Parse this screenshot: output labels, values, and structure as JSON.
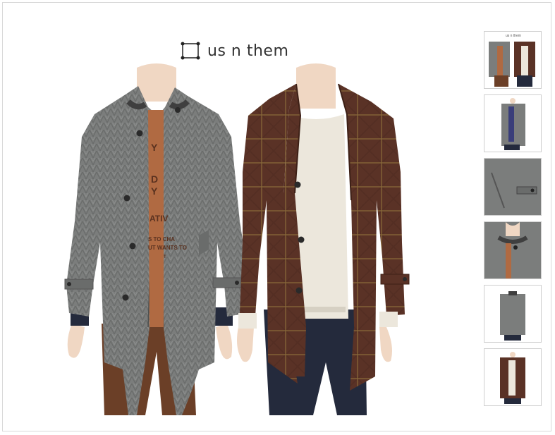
{
  "brand": {
    "name": "us n them",
    "logo_icon": "dot-square-logo-icon"
  },
  "product_gallery": {
    "main_image": {
      "description_items": [
        "gray-herringbone-coat",
        "brown-check-coat"
      ],
      "tee_print_lines": [
        "Y",
        "D",
        "Y",
        "ATIV",
        "S TO CHA",
        "UT WANTS TO",
        "T"
      ]
    },
    "thumbnails": [
      {
        "label": "us n them",
        "variant": "both-coats"
      },
      {
        "variant": "gray-coat-front"
      },
      {
        "variant": "pocket-detail"
      },
      {
        "variant": "collar-detail"
      },
      {
        "variant": "gray-coat-back"
      },
      {
        "variant": "brown-coat-front"
      }
    ]
  },
  "colors": {
    "gray_coat": "#7b7d7c",
    "brown_coat": "#5a3226",
    "tee_orange": "#b06a42",
    "sweater": "#ece7dc",
    "mannequin": "#f0d7c3",
    "pants_brown": "#6b3f27",
    "pants_navy": "#242a3c"
  }
}
